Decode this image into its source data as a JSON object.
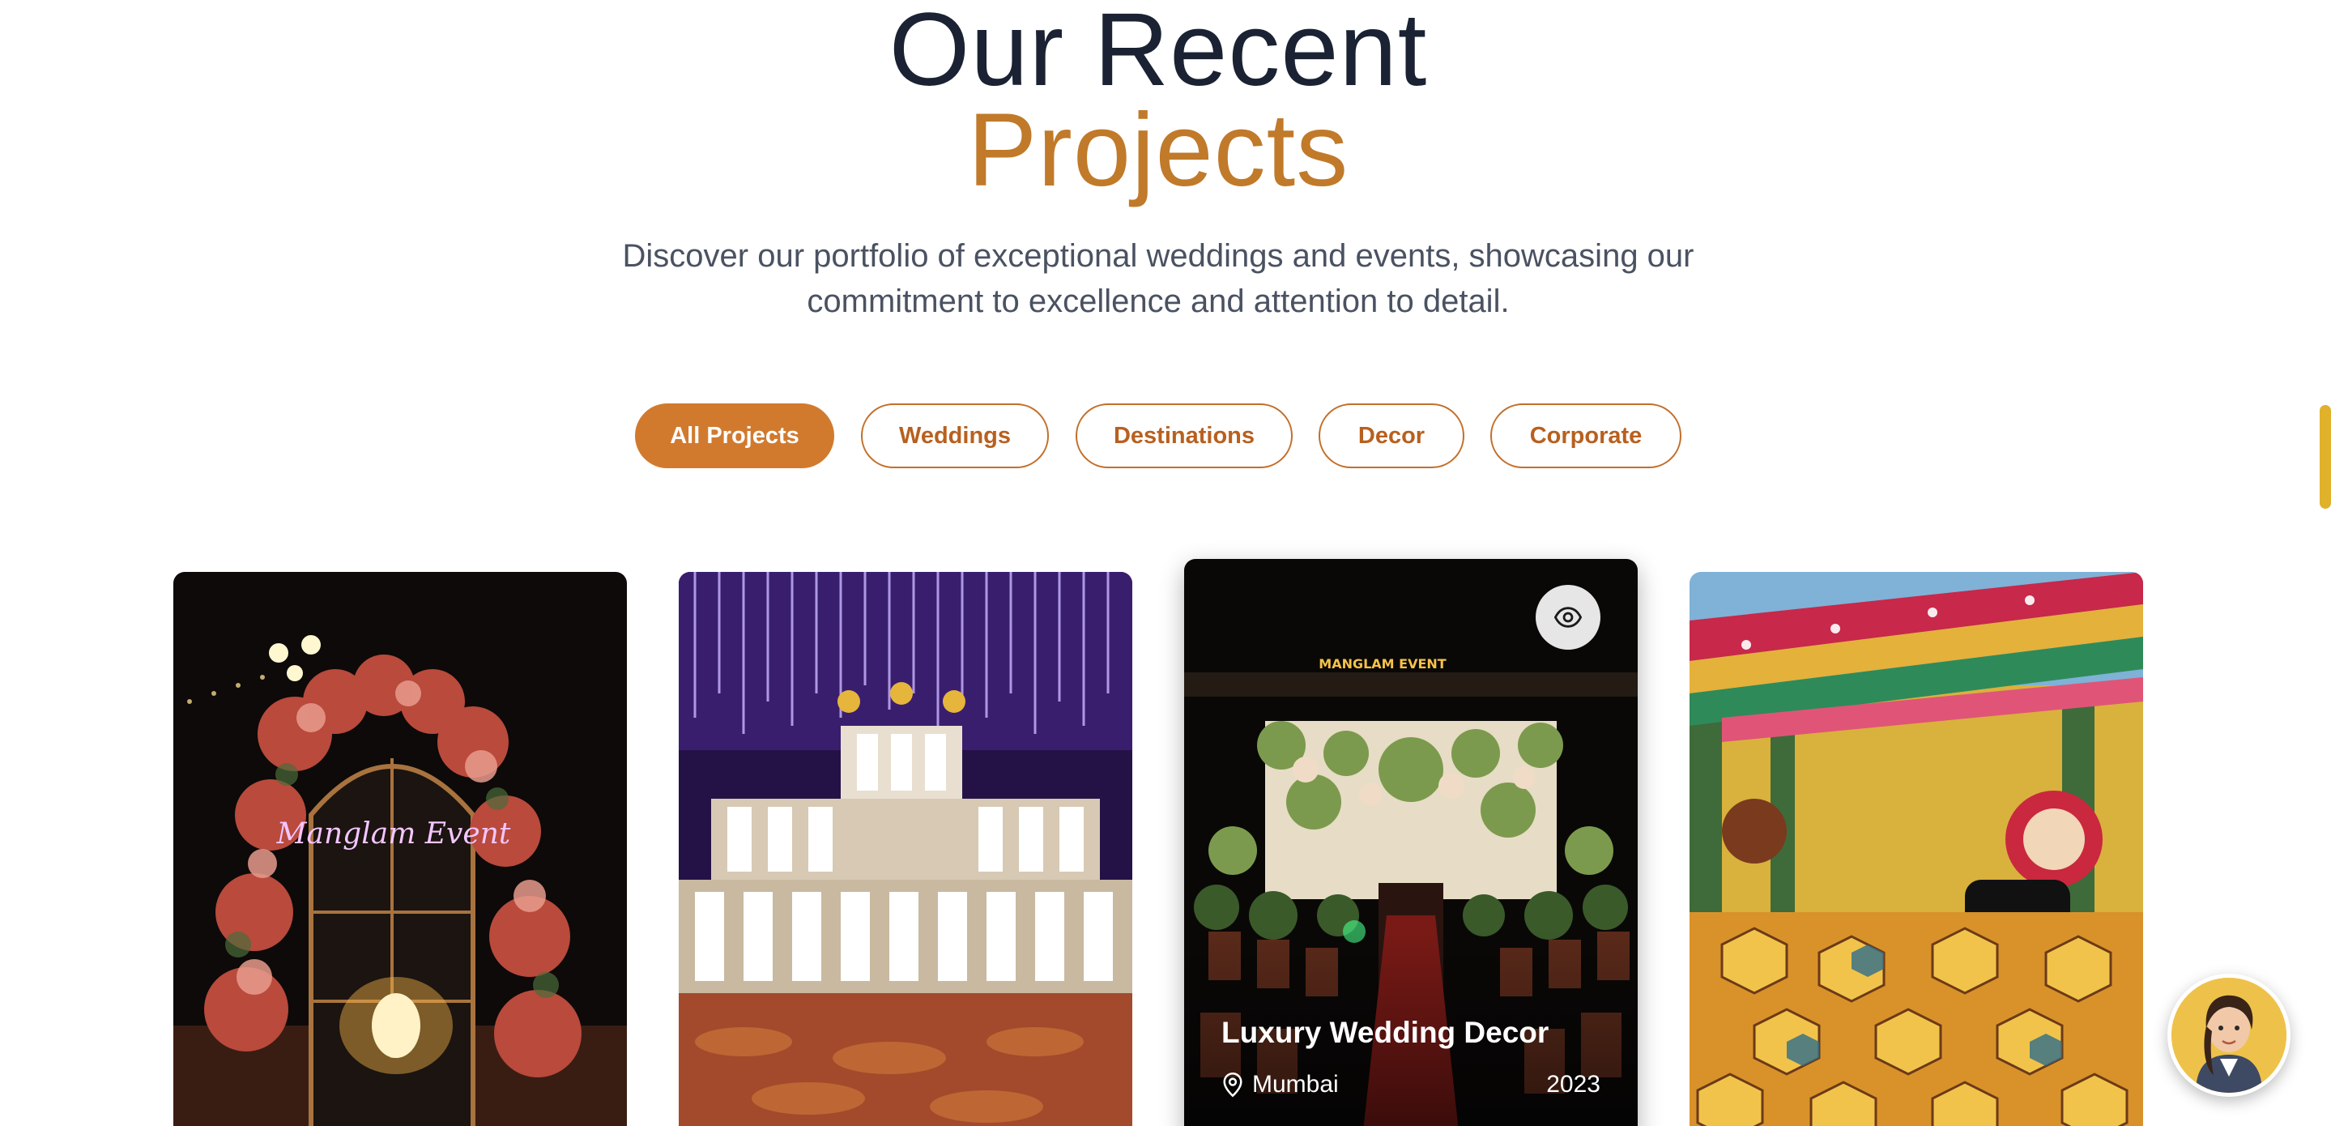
{
  "section": {
    "title_line1": "Our Recent",
    "title_line2": "Projects",
    "subtitle": "Discover our portfolio of exceptional weddings and events, showcasing our commitment to excellence and attention to detail."
  },
  "filters": [
    {
      "label": "All Projects",
      "active": true
    },
    {
      "label": "Weddings",
      "active": false
    },
    {
      "label": "Destinations",
      "active": false
    },
    {
      "label": "Decor",
      "active": false
    },
    {
      "label": "Corporate",
      "active": false
    }
  ],
  "projects": [
    {
      "image": "floral arch with neon Manglam Event sign",
      "neon_text": "Manglam Event"
    },
    {
      "image": "stage with purple hanging lights"
    },
    {
      "image": "wedding stage with floral decor",
      "title": "Luxury Wedding Decor",
      "location": "Mumbai",
      "year": "2023",
      "sign_text": "MANGLAM EVENT"
    },
    {
      "image": "colorful outdoor mehndi setup"
    }
  ],
  "icons": {
    "view": "eye-icon",
    "location": "map-pin-icon",
    "assistant": "assistant-avatar"
  },
  "colors": {
    "accent": "#d17a2e",
    "title_dark": "#1a2233",
    "title_gold": "#c07a2a",
    "scrollbar": "#e0b12b"
  }
}
